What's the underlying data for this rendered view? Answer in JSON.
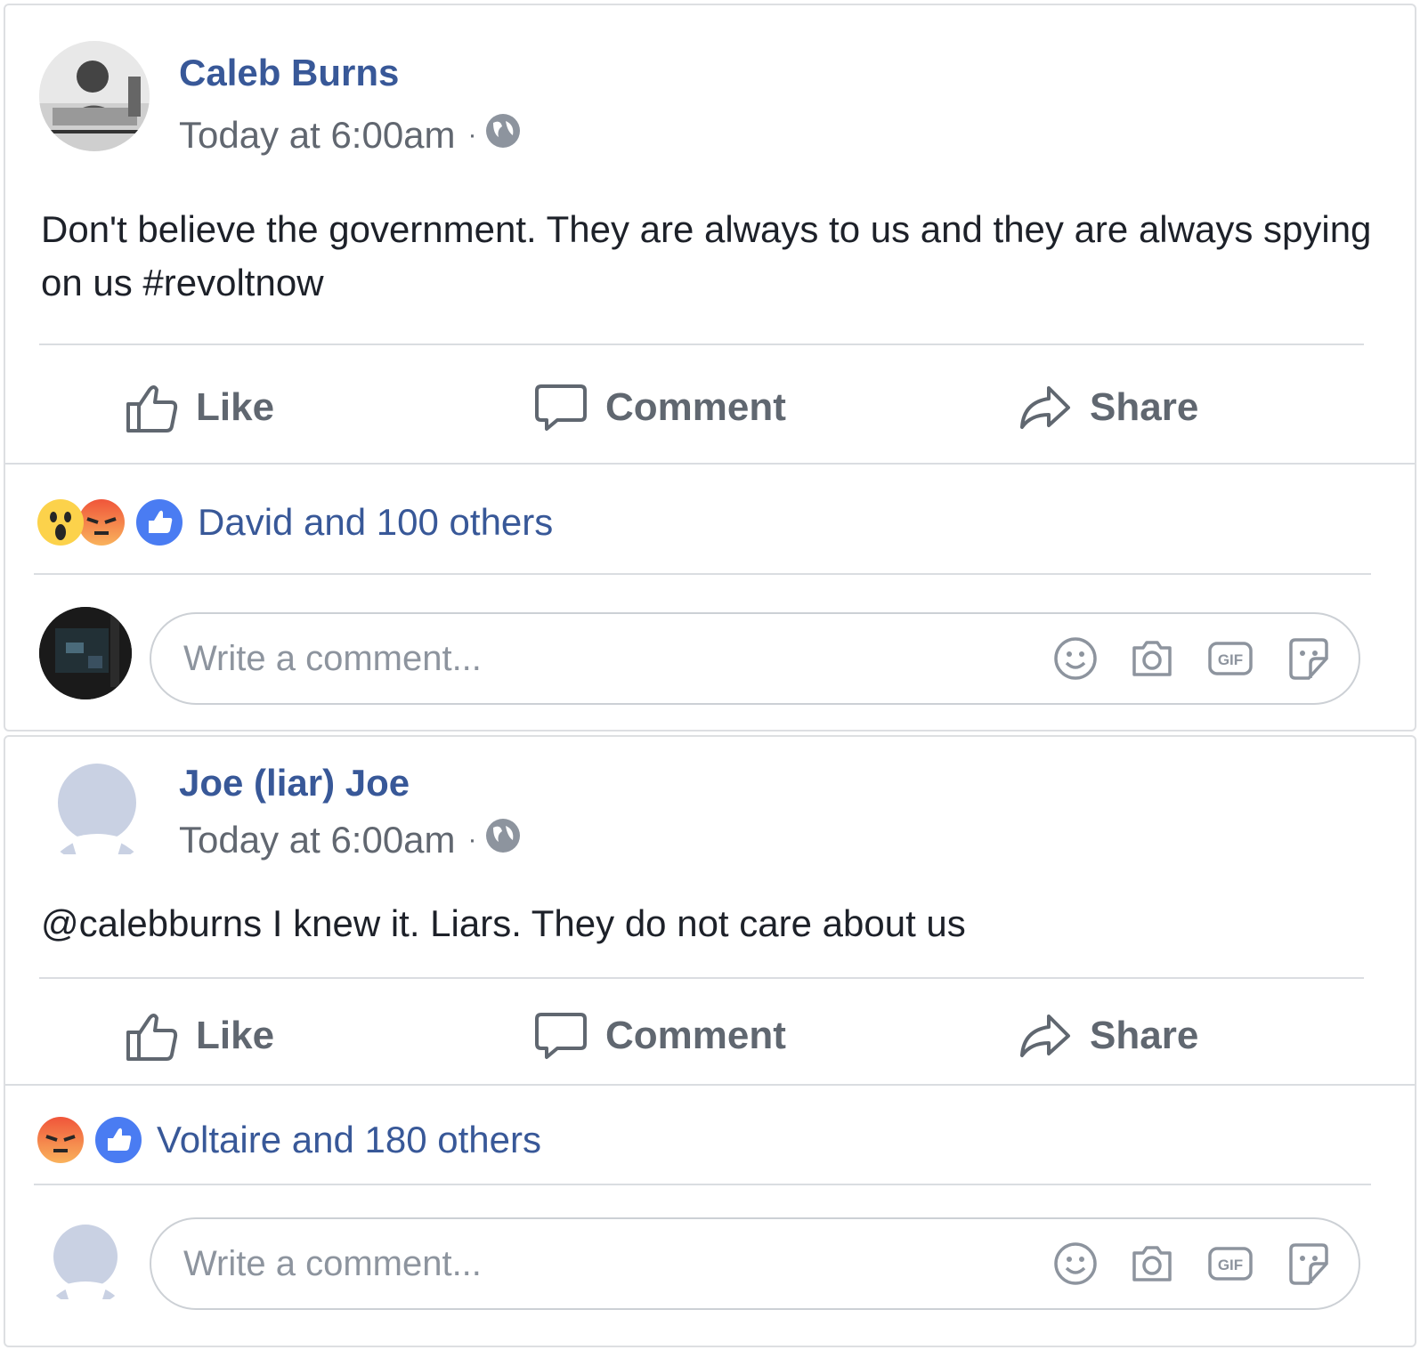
{
  "posts": [
    {
      "author": "Caleb Burns",
      "timestamp": "Today at 6:00am",
      "separator": "·",
      "privacy_icon": "globe-icon",
      "text": "Don't believe the government. They are always to us and they are always spying on us #revoltnow",
      "actions": {
        "like": "Like",
        "comment": "Comment",
        "share": "Share"
      },
      "reactions": [
        "wow",
        "angry",
        "like"
      ],
      "reactions_label": "David and 100 others",
      "comment_placeholder": "Write a comment..."
    },
    {
      "author": "Joe (liar) Joe",
      "timestamp": "Today at 6:00am",
      "separator": "·",
      "privacy_icon": "globe-icon",
      "text": "@calebburns I knew it. Liars. They do not care about us",
      "actions": {
        "like": "Like",
        "comment": "Comment",
        "share": "Share"
      },
      "reactions": [
        "angry",
        "like"
      ],
      "reactions_label": "Voltaire and 180 others",
      "comment_placeholder": "Write a comment..."
    }
  ],
  "colors": {
    "link": "#385898",
    "muted": "#606770",
    "like_blue": "#4a7cf2",
    "angry": "#f0553a",
    "wow": "#fcd24b"
  }
}
